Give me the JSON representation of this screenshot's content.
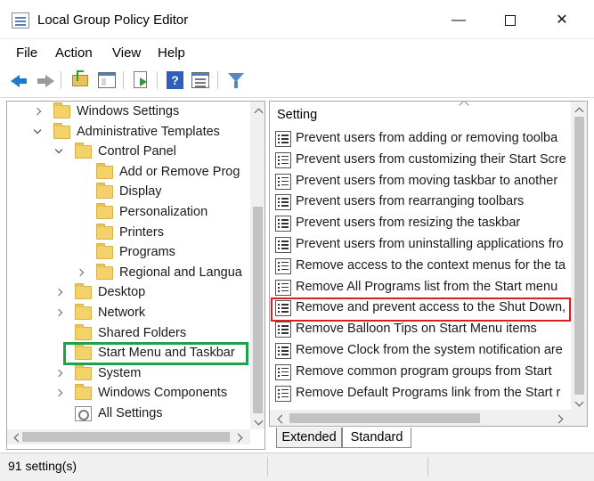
{
  "window": {
    "title": "Local Group Policy Editor",
    "minimize_glyph": "—",
    "close_glyph": "✕"
  },
  "menu": [
    "File",
    "Action",
    "View",
    "Help"
  ],
  "toolbar": [
    "back-icon",
    "forward-icon",
    "up-folder-icon",
    "show-hide-console-tree-icon",
    "export-list-icon",
    "help-icon",
    "properties-icon",
    "filter-icon"
  ],
  "tree": [
    {
      "label": "Windows Settings",
      "icon": "folder-icon",
      "expander": "collapsed"
    },
    {
      "label": "Administrative Templates",
      "icon": "folder-icon",
      "expander": "expanded"
    },
    {
      "label": "Control Panel",
      "icon": "folder-icon",
      "expander": "expanded"
    },
    {
      "label": "Add or Remove Prog",
      "icon": "folder-icon",
      "expander": "none"
    },
    {
      "label": "Display",
      "icon": "folder-icon",
      "expander": "none"
    },
    {
      "label": "Personalization",
      "icon": "folder-icon",
      "expander": "none"
    },
    {
      "label": "Printers",
      "icon": "folder-icon",
      "expander": "none"
    },
    {
      "label": "Programs",
      "icon": "folder-icon",
      "expander": "none"
    },
    {
      "label": "Regional and Langua",
      "icon": "folder-icon",
      "expander": "collapsed"
    },
    {
      "label": "Desktop",
      "icon": "folder-icon",
      "expander": "collapsed"
    },
    {
      "label": "Network",
      "icon": "folder-icon",
      "expander": "collapsed"
    },
    {
      "label": "Shared Folders",
      "icon": "folder-icon",
      "expander": "none"
    },
    {
      "label": "Start Menu and Taskbar",
      "icon": "folder-icon",
      "expander": "none",
      "highlight": "#1fa34a"
    },
    {
      "label": "System",
      "icon": "folder-icon",
      "expander": "collapsed"
    },
    {
      "label": "Windows Components",
      "icon": "folder-icon",
      "expander": "collapsed"
    },
    {
      "label": "All Settings",
      "icon": "all-settings-icon",
      "expander": "none"
    }
  ],
  "settings_list": {
    "column_header": "Setting",
    "items": [
      "Prevent users from adding or removing toolba",
      "Prevent users from customizing their Start Scre",
      "Prevent users from moving taskbar to another",
      "Prevent users from rearranging toolbars",
      "Prevent users from resizing the taskbar",
      "Prevent users from uninstalling applications fro",
      "Remove access to the context menus for the ta",
      "Remove All Programs list from the Start menu",
      "Remove and prevent access to the Shut Down,",
      "Remove Balloon Tips on Start Menu items",
      "Remove Clock from the system notification are",
      "Remove common program groups from Start",
      "Remove Default Programs link from the Start r"
    ],
    "highlighted_item": "Remove and prevent access to the Shut Down,",
    "highlight_color": "#d42020"
  },
  "tabs": [
    "Extended",
    "Standard"
  ],
  "active_tab": "Standard",
  "status": "91 setting(s)"
}
